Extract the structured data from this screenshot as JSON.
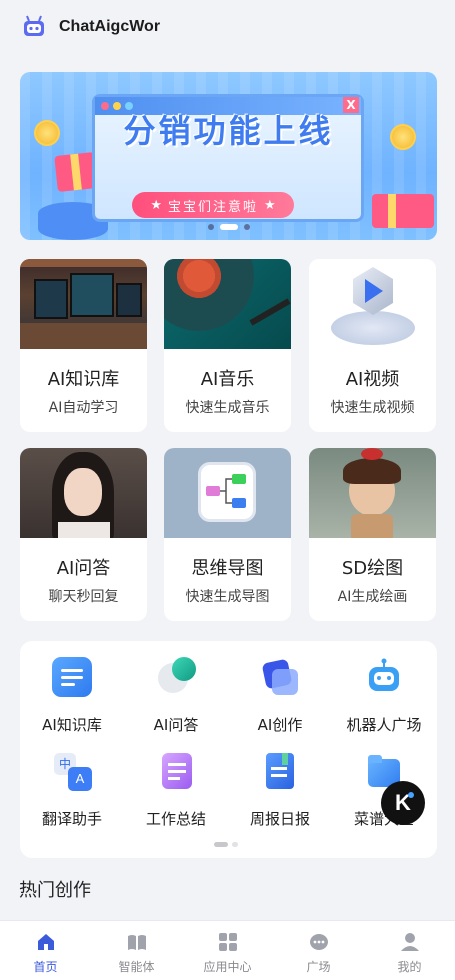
{
  "header": {
    "title": "ChatAigcWor",
    "logo_icon": "robot-icon"
  },
  "banner": {
    "title": "分销功能上线",
    "pill_text": "宝宝们注意啦",
    "pill_star_left": "★",
    "pill_star_right": "★",
    "close_glyph": "X",
    "slides": 3,
    "active_slide": 1
  },
  "features": [
    {
      "title": "AI知识库",
      "subtitle": "AI自动学习",
      "image": "computer-desk-photo"
    },
    {
      "title": "AI音乐",
      "subtitle": "快速生成音乐",
      "image": "vinyl-record-photo"
    },
    {
      "title": "AI视频",
      "subtitle": "快速生成视频",
      "image": "play-logo-3d"
    },
    {
      "title": "AI问答",
      "subtitle": "聊天秒回复",
      "image": "woman-portrait-photo"
    },
    {
      "title": "思维导图",
      "subtitle": "快速生成导图",
      "image": "mindmap-icon"
    },
    {
      "title": "SD绘图",
      "subtitle": "AI生成绘画",
      "image": "cartoon-girl-painting"
    }
  ],
  "tools": [
    {
      "label": "AI知识库",
      "icon": "knowledge-base-icon",
      "color": "#3d8cf7"
    },
    {
      "label": "AI问答",
      "icon": "chat-bubble-icon",
      "color": "#1fb39a"
    },
    {
      "label": "AI创作",
      "icon": "create-icon",
      "color": "#4a6cf7"
    },
    {
      "label": "机器人广场",
      "icon": "robot-icon",
      "color": "#3aa0f5"
    },
    {
      "label": "翻译助手",
      "icon": "translate-icon",
      "color": "#3d7df5"
    },
    {
      "label": "工作总结",
      "icon": "document-icon",
      "color": "#b16cf0"
    },
    {
      "label": "周报日报",
      "icon": "notebook-icon",
      "color": "#3d7cf2"
    },
    {
      "label": "菜谱大全",
      "icon": "folder-icon",
      "color": "#2f8df5"
    }
  ],
  "tools_pager": {
    "pages": 2,
    "active": 1
  },
  "fab": {
    "label": "K",
    "icon": "assistant-icon"
  },
  "hot_section": {
    "title": "热门创作"
  },
  "tabbar": [
    {
      "label": "首页",
      "icon": "home-icon",
      "active": true
    },
    {
      "label": "智能体",
      "icon": "book-icon",
      "active": false
    },
    {
      "label": "应用中心",
      "icon": "grid-icon",
      "active": false
    },
    {
      "label": "广场",
      "icon": "chat-icon",
      "active": false
    },
    {
      "label": "我的",
      "icon": "user-icon",
      "active": false
    }
  ],
  "colors": {
    "accent": "#3b5bdb",
    "background": "#f2f3f7",
    "banner_blue": "#6fb3ff",
    "pill_pink": "#ff4f7d"
  }
}
